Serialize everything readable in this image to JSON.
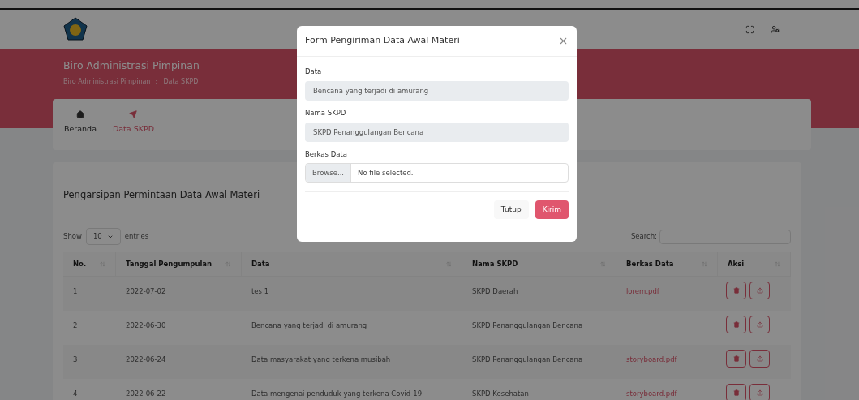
{
  "banner": {
    "title": "Biro Administrasi Pimpinan",
    "breadcrumb": [
      "Biro Administrasi Pimpinan",
      "Data SKPD"
    ]
  },
  "nav": [
    {
      "label": "Beranda",
      "selected": false
    },
    {
      "label": "Data SKPD",
      "selected": true
    }
  ],
  "table_card": {
    "title": "Pengarsipan Permintaan Data Awal Materi",
    "show_label": "Show",
    "page_length": "10",
    "entries_label": "entries",
    "search_label": "Search:",
    "columns": [
      "No.",
      "Tanggal Pengumpulan",
      "Data",
      "Nama SKPD",
      "Berkas Data",
      "Aksi"
    ],
    "rows": [
      {
        "no": "1",
        "date": "2022-07-02",
        "data": "tes 1",
        "skpd": "SKPD Daerah",
        "file": "lorem.pdf"
      },
      {
        "no": "2",
        "date": "2022-06-30",
        "data": "Bencana yang terjadi di amurang",
        "skpd": "SKPD Penanggulangan Bencana"
      },
      {
        "no": "3",
        "date": "2022-06-24",
        "data": "Data masyarakat yang terkena musibah",
        "skpd": "SKPD Penanggulangan Bencana",
        "file": "storyboard.pdf"
      },
      {
        "no": "4",
        "date": "2022-06-22",
        "data": "Data mengenai penduduk yang terkena Covid-19",
        "skpd": "SKPD Kesehatan",
        "file": "storyboard.pdf"
      }
    ]
  },
  "modal": {
    "title": "Form Pengiriman Data Awal Materi",
    "fields": [
      {
        "kind": "readonly",
        "label": "Data",
        "value": "Bencana yang terjadi di amurang"
      },
      {
        "kind": "readonly",
        "label": "Nama SKPD",
        "value": "SKPD Penanggulangan Bencana"
      },
      {
        "kind": "file",
        "label": "Berkas Data",
        "button": "Browse...",
        "value": "No file selected."
      }
    ],
    "buttons": [
      {
        "label": "Tutup",
        "kind": "secondary"
      },
      {
        "label": "Kirim",
        "kind": "primary"
      }
    ]
  }
}
